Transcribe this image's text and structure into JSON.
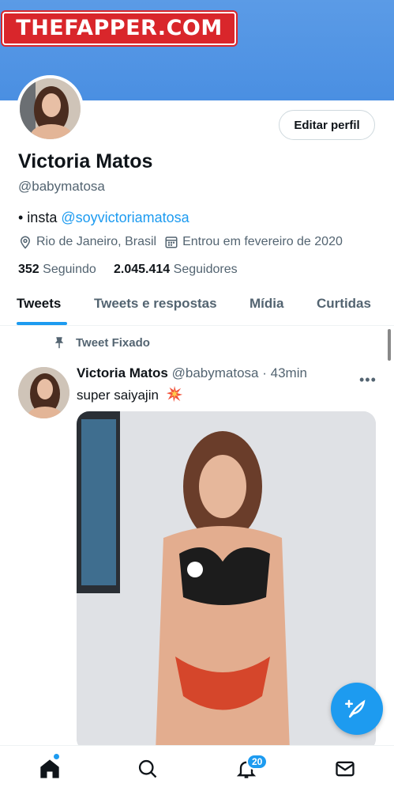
{
  "watermark": {
    "text": "THEFAPPER.COM"
  },
  "profile": {
    "edit_label": "Editar perfil",
    "name": "Victoria Matos",
    "handle": "@babymatosa",
    "bio_prefix": "• insta ",
    "bio_link": "@soyvictoriamatosa",
    "location": "Rio de Janeiro, Brasil",
    "joined": "Entrou em fevereiro de 2020",
    "following_count": "352",
    "following_label": "Seguindo",
    "followers_count": "2.045.414",
    "followers_label": "Seguidores"
  },
  "tabs": [
    {
      "label": "Tweets",
      "active": true
    },
    {
      "label": "Tweets e respostas",
      "active": false
    },
    {
      "label": "Mídia",
      "active": false
    },
    {
      "label": "Curtidas",
      "active": false
    }
  ],
  "tweet": {
    "pinned_label": "Tweet Fixado",
    "author_name": "Victoria Matos",
    "author_handle": "@babymatosa",
    "separator": "·",
    "time": "43min",
    "text": "super saiyajin",
    "emoji_icon": "collision-icon"
  },
  "nav": {
    "notifications_badge": "20",
    "items": [
      "home-icon",
      "search-icon",
      "bell-icon",
      "mail-icon"
    ]
  },
  "colors": {
    "accent": "#1d9bf0",
    "banner": "#4a8fe2",
    "watermark_bg": "#d9262b"
  }
}
